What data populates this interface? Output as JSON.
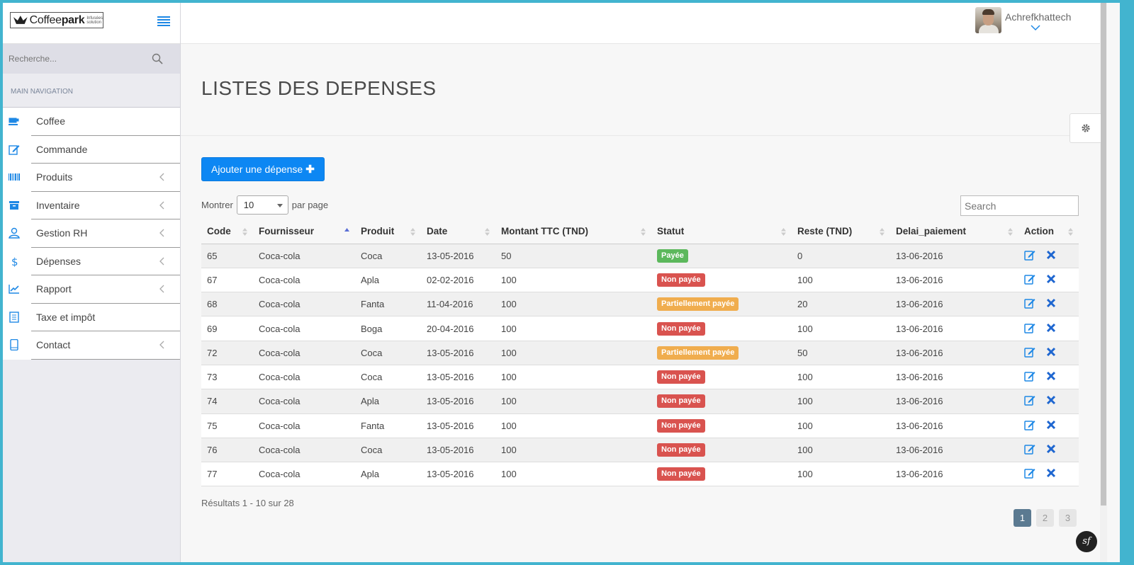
{
  "brand": {
    "logo_word": "Coffee",
    "logo_word_bold": "park",
    "logo_tag_line1": "Infusées",
    "logo_tag_line2": "solution"
  },
  "sidebar": {
    "search_placeholder": "Recherche...",
    "nav_header": "MAIN NAVIGATION",
    "items": [
      {
        "label": "Coffee",
        "icon": "coffee-cup-icon",
        "has_chevron": false
      },
      {
        "label": "Commande",
        "icon": "edit-icon",
        "has_chevron": false
      },
      {
        "label": "Produits",
        "icon": "barcode-icon",
        "has_chevron": true
      },
      {
        "label": "Inventaire",
        "icon": "archive-icon",
        "has_chevron": true
      },
      {
        "label": "Gestion RH",
        "icon": "user-icon",
        "has_chevron": true
      },
      {
        "label": "Dépenses",
        "icon": "dollar-icon",
        "has_chevron": true
      },
      {
        "label": "Rapport",
        "icon": "line-chart-icon",
        "has_chevron": true
      },
      {
        "label": "Taxe et impôt",
        "icon": "receipt-icon",
        "has_chevron": false
      },
      {
        "label": "Contact",
        "icon": "mobile-icon",
        "has_chevron": true
      }
    ]
  },
  "topbar": {
    "username": "Achrefkhattech"
  },
  "page": {
    "title": "LISTES DES DEPENSES"
  },
  "toolbar": {
    "add_button_label": "Ajouter une dépense",
    "add_button_icon": "plus-icon"
  },
  "table_controls": {
    "show_prefix": "Montrer",
    "page_size": "10",
    "show_suffix": "par page",
    "search_placeholder": "Search"
  },
  "table": {
    "columns": [
      "Code",
      "Fournisseur",
      "Produit",
      "Date",
      "Montant TTC (TND)",
      "Statut",
      "Reste (TND)",
      "Delai_paiement",
      "Action"
    ],
    "rows": [
      {
        "code": "65",
        "fournisseur": "Coca-cola",
        "produit": "Coca",
        "date": "13-05-2016",
        "montant": "50",
        "statut": "Payée",
        "reste": "0",
        "delai": "13-06-2016"
      },
      {
        "code": "67",
        "fournisseur": "Coca-cola",
        "produit": "Apla",
        "date": "02-02-2016",
        "montant": "100",
        "statut": "Non payée",
        "reste": "100",
        "delai": "13-06-2016"
      },
      {
        "code": "68",
        "fournisseur": "Coca-cola",
        "produit": "Fanta",
        "date": "11-04-2016",
        "montant": "100",
        "statut": "Partiellement payée",
        "reste": "20",
        "delai": "13-06-2016"
      },
      {
        "code": "69",
        "fournisseur": "Coca-cola",
        "produit": "Boga",
        "date": "20-04-2016",
        "montant": "100",
        "statut": "Non payée",
        "reste": "100",
        "delai": "13-06-2016"
      },
      {
        "code": "72",
        "fournisseur": "Coca-cola",
        "produit": "Coca",
        "date": "13-05-2016",
        "montant": "100",
        "statut": "Partiellement payée",
        "reste": "50",
        "delai": "13-06-2016"
      },
      {
        "code": "73",
        "fournisseur": "Coca-cola",
        "produit": "Coca",
        "date": "13-05-2016",
        "montant": "100",
        "statut": "Non payée",
        "reste": "100",
        "delai": "13-06-2016"
      },
      {
        "code": "74",
        "fournisseur": "Coca-cola",
        "produit": "Apla",
        "date": "13-05-2016",
        "montant": "100",
        "statut": "Non payée",
        "reste": "100",
        "delai": "13-06-2016"
      },
      {
        "code": "75",
        "fournisseur": "Coca-cola",
        "produit": "Fanta",
        "date": "13-05-2016",
        "montant": "100",
        "statut": "Non payée",
        "reste": "100",
        "delai": "13-06-2016"
      },
      {
        "code": "76",
        "fournisseur": "Coca-cola",
        "produit": "Coca",
        "date": "13-05-2016",
        "montant": "100",
        "statut": "Non payée",
        "reste": "100",
        "delai": "13-06-2016"
      },
      {
        "code": "77",
        "fournisseur": "Coca-cola",
        "produit": "Apla",
        "date": "13-05-2016",
        "montant": "100",
        "statut": "Non payée",
        "reste": "100",
        "delai": "13-06-2016"
      }
    ]
  },
  "status_colors": {
    "Payée": "#5cb85c",
    "Non payée": "#d9534f",
    "Partiellement payée": "#f0ad4e"
  },
  "accent_color": "#0d87f3",
  "footer": {
    "results_text": "Résultats 1 - 10 sur 28",
    "pages": [
      "1",
      "2",
      "3"
    ],
    "active_page": "1"
  },
  "badge_sf": "sf"
}
